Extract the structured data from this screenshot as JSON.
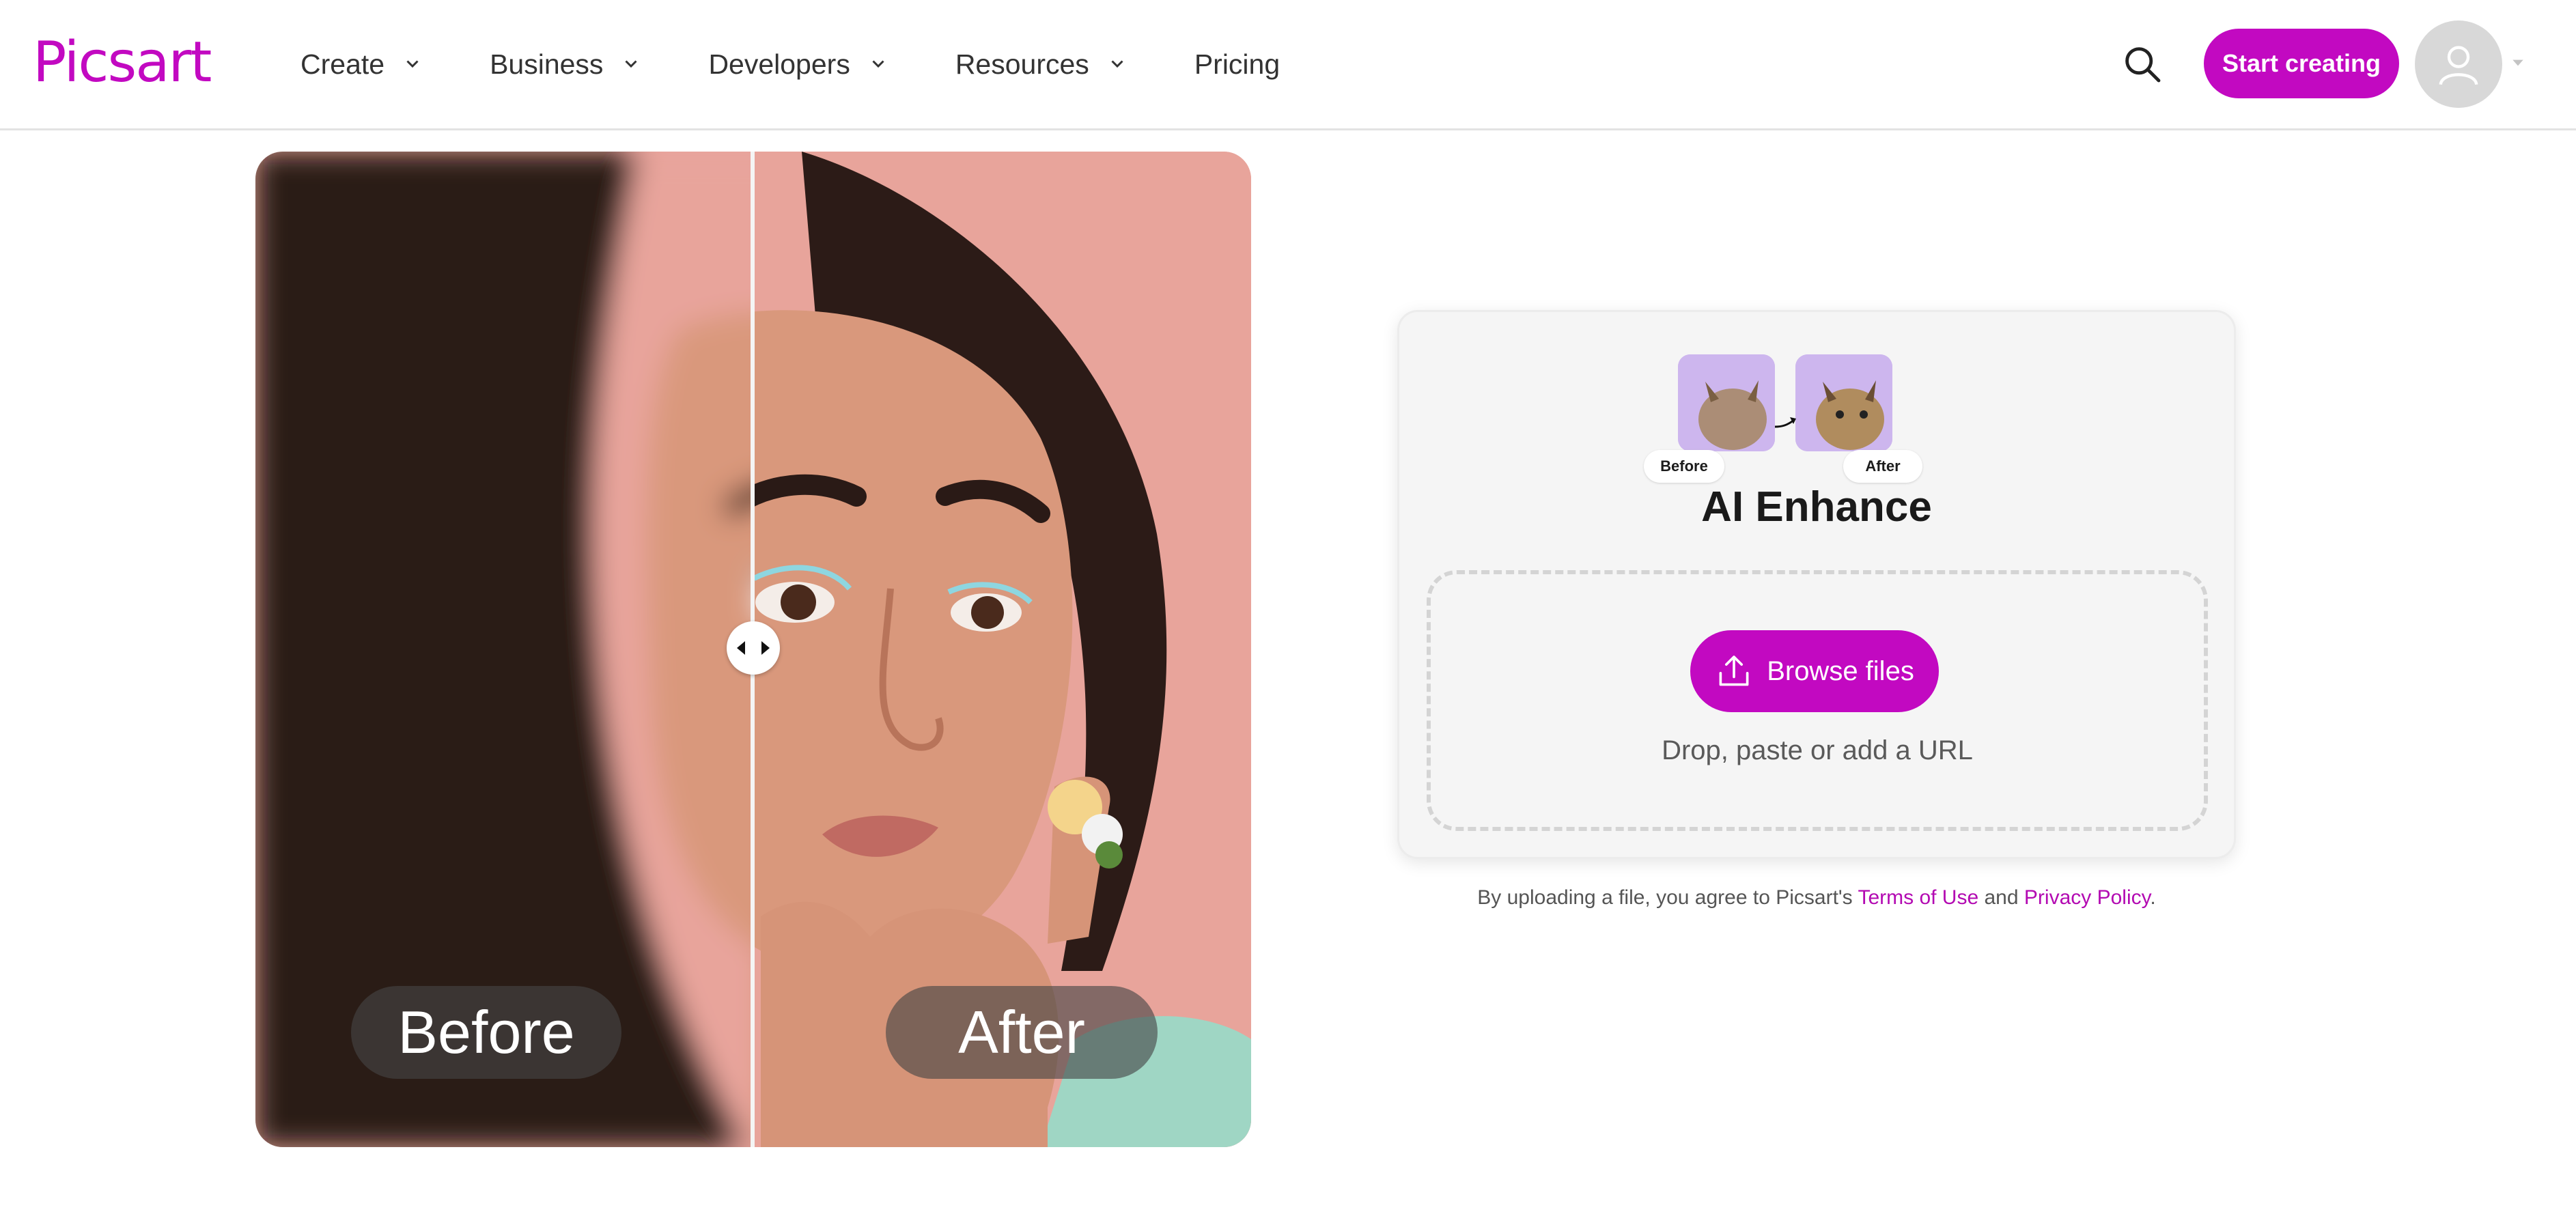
{
  "header": {
    "logo": "Picsart",
    "nav": [
      {
        "label": "Create",
        "has_dropdown": true
      },
      {
        "label": "Business",
        "has_dropdown": true
      },
      {
        "label": "Developers",
        "has_dropdown": true
      },
      {
        "label": "Resources",
        "has_dropdown": true
      },
      {
        "label": "Pricing",
        "has_dropdown": false
      }
    ],
    "cta_label": "Start creating",
    "icons": {
      "search": "search-icon",
      "avatar": "user-icon",
      "caret": "caret-down-icon"
    }
  },
  "compare": {
    "before_label": "Before",
    "after_label": "After",
    "split_position": 0.5
  },
  "card": {
    "preview_before": "Before",
    "preview_after": "After",
    "title": "AI Enhance",
    "browse_label": "Browse files",
    "drop_hint": "Drop, paste or add a URL"
  },
  "legal": {
    "prefix": "By uploading a file, you agree to Picsart's",
    "terms": "Terms of Use",
    "and": "and",
    "privacy": "Privacy Policy",
    "suffix": "."
  },
  "colors": {
    "brand": "#c209c1",
    "text": "#1c1c1c",
    "card_bg": "#f5f5f5",
    "photo_bg": "#e9a39c"
  }
}
